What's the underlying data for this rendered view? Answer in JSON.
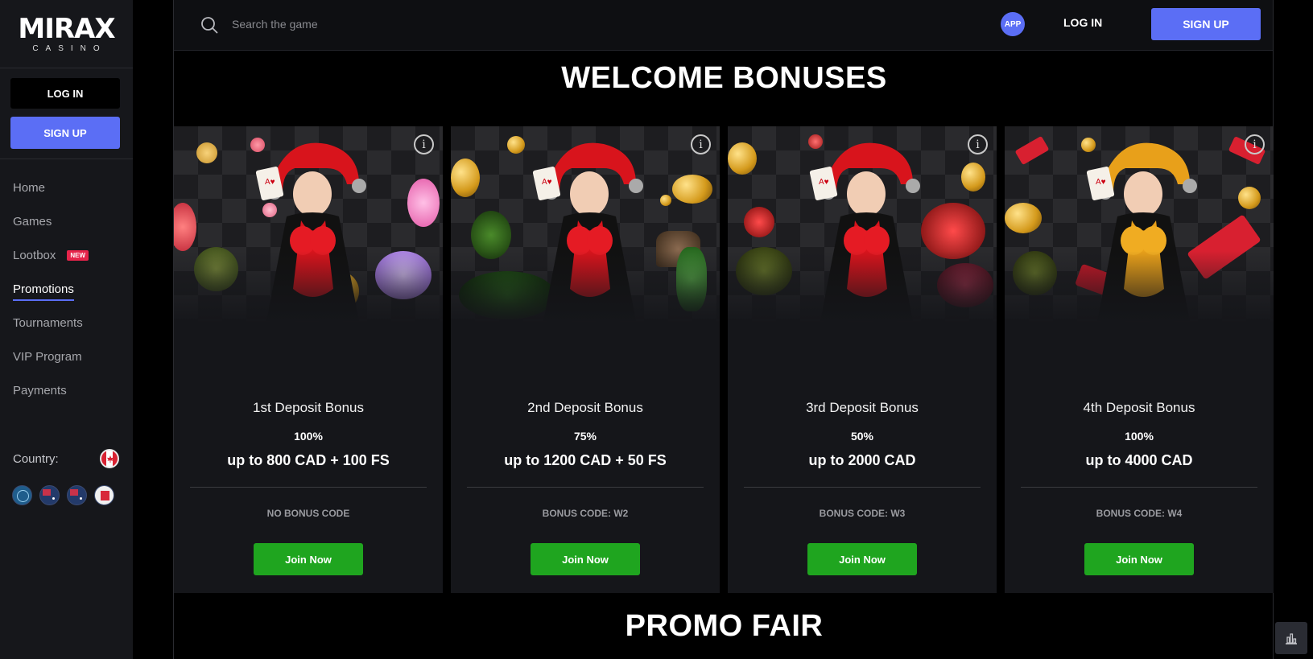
{
  "brand": {
    "logo_main": "MIRAX",
    "logo_sub": "CASINO"
  },
  "sidebar": {
    "login_label": "LOG IN",
    "signup_label": "SIGN UP",
    "items": [
      {
        "label": "Home"
      },
      {
        "label": "Games"
      },
      {
        "label": "Lootbox",
        "badge": "NEW"
      },
      {
        "label": "Promotions",
        "active": true
      },
      {
        "label": "Tournaments"
      },
      {
        "label": "VIP Program"
      },
      {
        "label": "Payments"
      }
    ],
    "country_label": "Country:",
    "country_flag": "canada-flag-icon",
    "languages": [
      "globe-icon",
      "australia-flag-icon",
      "new-zealand-flag-icon",
      "canada-french-flag-icon"
    ]
  },
  "header": {
    "search_placeholder": "Search the game",
    "app_label": "APP",
    "login_label": "LOG IN",
    "signup_label": "SIGN UP"
  },
  "welcome": {
    "title": "WELCOME BONUSES",
    "cards": [
      {
        "title": "1st Deposit Bonus",
        "percent": "100%",
        "amount": "up to 800 CAD + 100 FS",
        "code": "NO BONUS CODE",
        "button": "Join Now",
        "theme": "candy",
        "suit_color": "#d8141c"
      },
      {
        "title": "2nd Deposit Bonus",
        "percent": "75%",
        "amount": "up to 1200 CAD + 50 FS",
        "code": "BONUS CODE: W2",
        "button": "Join Now",
        "theme": "cactus",
        "suit_color": "#d8141c"
      },
      {
        "title": "3rd Deposit Bonus",
        "percent": "50%",
        "amount": "up to 2000 CAD",
        "code": "BONUS CODE: W3",
        "button": "Join Now",
        "theme": "chips",
        "suit_color": "#d8141c"
      },
      {
        "title": "4th Deposit Bonus",
        "percent": "100%",
        "amount": "up to 4000 CAD",
        "code": "BONUS CODE: W4",
        "button": "Join Now",
        "theme": "tickets",
        "suit_color": "#e8a01a"
      }
    ]
  },
  "promo": {
    "title": "PROMO FAIR"
  },
  "colors": {
    "accent": "#5b6ef5",
    "join": "#1fa51f",
    "new_badge": "#e6244a"
  }
}
